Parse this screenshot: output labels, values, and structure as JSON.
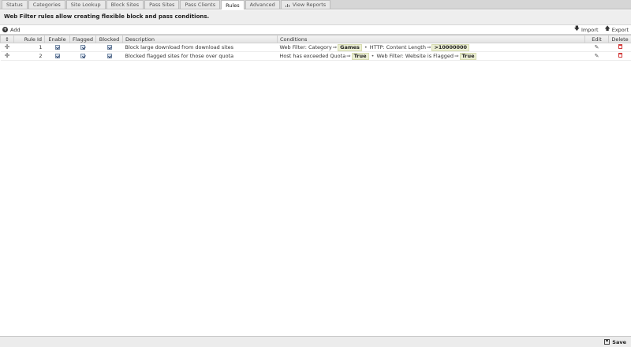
{
  "tabs": [
    {
      "label": "Status",
      "active": false
    },
    {
      "label": "Categories",
      "active": false
    },
    {
      "label": "Site Lookup",
      "active": false
    },
    {
      "label": "Block Sites",
      "active": false
    },
    {
      "label": "Pass Sites",
      "active": false
    },
    {
      "label": "Pass Clients",
      "active": false
    },
    {
      "label": "Rules",
      "active": true
    },
    {
      "label": "Advanced",
      "active": false
    },
    {
      "label": "View Reports",
      "active": false
    }
  ],
  "intro": "Web Filter rules allow creating flexible block and pass conditions.",
  "toolbar": {
    "add_label": "Add",
    "import_label": "Import",
    "export_label": "Export"
  },
  "columns": {
    "rule_id": "Rule Id",
    "enable": "Enable",
    "flagged": "Flagged",
    "blocked": "Blocked",
    "description": "Description",
    "conditions": "Conditions",
    "edit": "Edit",
    "delete": "Delete"
  },
  "rows": [
    {
      "rule_id": "1",
      "enable": true,
      "flagged": true,
      "blocked": true,
      "description": "Block large download from download sites",
      "conditions": [
        {
          "label": "Web Filter: Category",
          "value": "Games"
        },
        {
          "label": "HTTP: Content Length",
          "value": ">10000000"
        }
      ]
    },
    {
      "rule_id": "2",
      "enable": true,
      "flagged": true,
      "blocked": true,
      "description": "Blocked flagged sites for those over quota",
      "conditions": [
        {
          "label": "Host has exceeded Quota",
          "value": "True"
        },
        {
          "label": "Web Filter: Website is Flagged",
          "value": "True"
        }
      ]
    }
  ],
  "footer": {
    "save_label": "Save"
  }
}
